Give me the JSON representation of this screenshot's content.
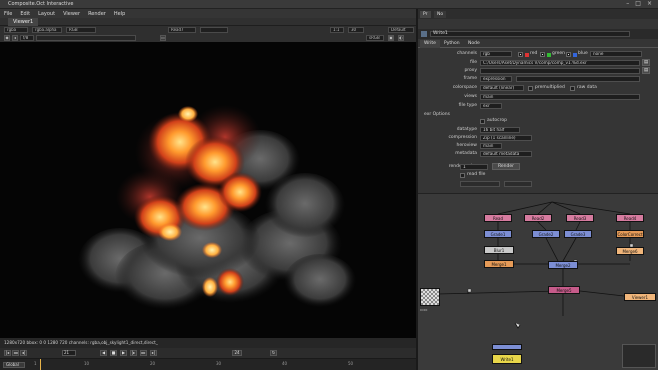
{
  "window": {
    "title": "Composite.Oct Interactive"
  },
  "menu": [
    "File",
    "Edit",
    "Layout",
    "Viewer",
    "Render",
    "Help"
  ],
  "viewer": {
    "tab": "Viewer1",
    "channels": "rgba",
    "layer": "rgba.alpha",
    "colorspace_view": "RGB",
    "input_a": "Read7",
    "zoom": "1:1",
    "proxy": "30",
    "lut": "Default",
    "gain_value": "f/8",
    "gamma_value": "sRGB",
    "info": "1280x720 bbox: 0 0 1280 720 channels: rgba,obj_skylight1_direct,direct_",
    "frame": "21",
    "fps": "24",
    "global_label": "Global",
    "ticks": [
      "1",
      "10",
      "20",
      "30",
      "40",
      "50"
    ]
  },
  "properties": {
    "tabs": [
      "Pr",
      "No"
    ],
    "node_name": "Write1",
    "subtabs": [
      "Write",
      "Python",
      "Node"
    ],
    "channels_label": "channels",
    "channels_value": "rgb",
    "rgb_checks": [
      "red",
      "green",
      "blue"
    ],
    "alpha_value": "none",
    "file_label": "file",
    "file_value": "C:/Users/Aset/Dynamics V/comp/comp_v1.%d.exr",
    "proxy_label": "proxy",
    "frame_label": "frame",
    "frame_value": "expression",
    "colorspace_label": "colorspace",
    "colorspace_value": "default (linear)",
    "premultiplied": "premultiplied",
    "raw_data": "raw data",
    "views_label": "views",
    "views_value": "main",
    "file_type_label": "file type",
    "file_type_value": "exr",
    "exr_options_label": "exr Options",
    "autocrop": "autocrop",
    "datatype_label": "datatype",
    "datatype_value": "16 bit half",
    "compression_label": "compression",
    "compression_value": "Zip (1 scanline)",
    "heroview_label": "heroview",
    "heroview_value": "main",
    "metadata_label": "metadata",
    "metadata_value": "default metadata",
    "render_order_label": "render order",
    "render_order_value": "1",
    "render_button": "Render",
    "read_file": "read file"
  },
  "nodegraph": {
    "nodes": [
      "Read",
      "Read2",
      "Read3",
      "Read4",
      "Merge1",
      "Merge2",
      "Grade1",
      "Grade2",
      "Grade3",
      "ColorCorrect",
      "Blur1",
      "Merge5",
      "Merge6",
      "Viewer1",
      "Write1"
    ],
    "viewer_node_label": "Viewer1"
  },
  "colors": {
    "accent": "#e8b44a",
    "node_pink": "#d67b9f",
    "node_blue": "#7c8ed4",
    "node_orange": "#e59a57",
    "node_yellow": "#e8d64a"
  }
}
